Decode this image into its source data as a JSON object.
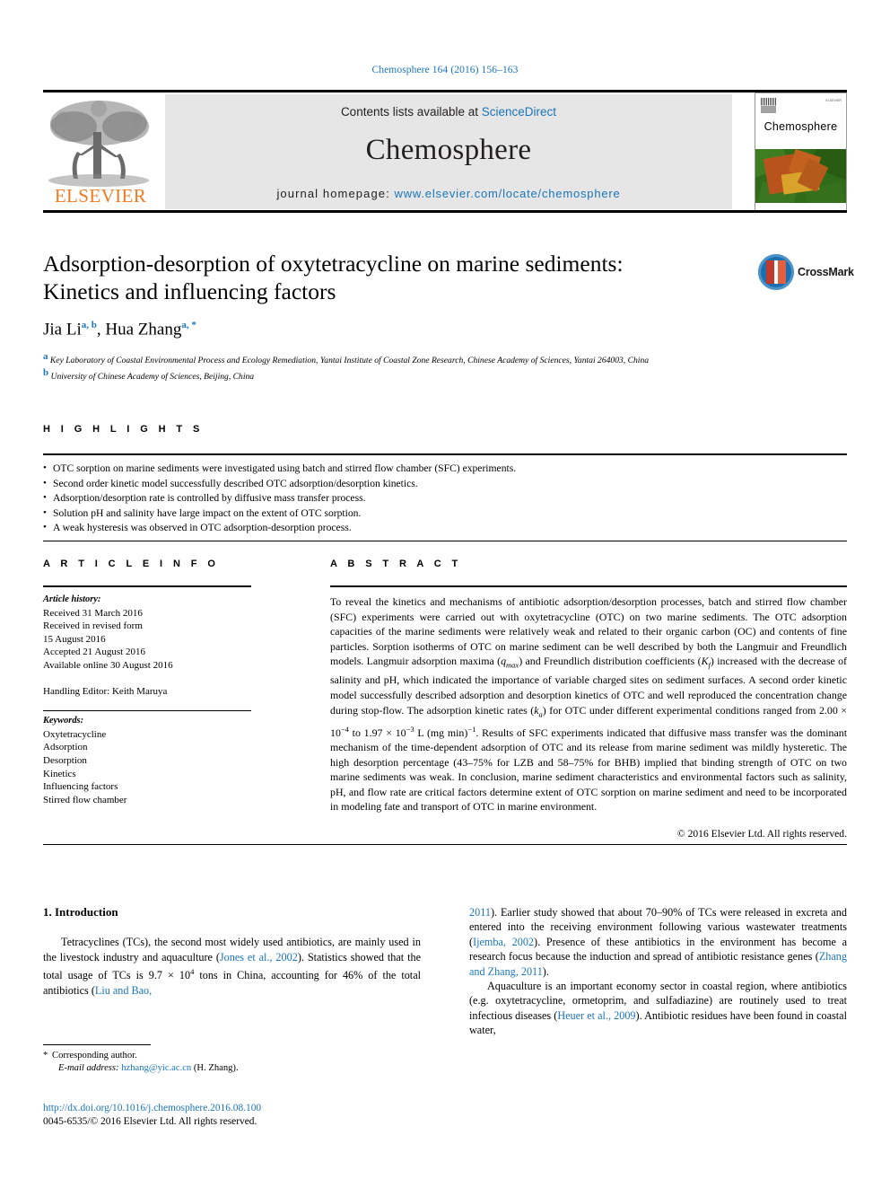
{
  "running_head": "Chemosphere 164 (2016) 156–163",
  "masthead": {
    "publisher_word": "ELSEVIER",
    "contents_prefix": "Contents lists available at ",
    "contents_link": "ScienceDirect",
    "journal_name": "Chemosphere",
    "homepage_prefix": "journal homepage: ",
    "homepage_url": "www.elsevier.com/locate/chemosphere",
    "cover_title": "Chemosphere",
    "cover_tiny_text": "ELSEVIER"
  },
  "crossmark": {
    "label": "CrossMark"
  },
  "article": {
    "title_line1": "Adsorption-desorption of oxytetracycline on marine sediments:",
    "title_line2": "Kinetics and influencing factors",
    "author1": "Jia Li",
    "author1_marks": "a, b",
    "author2": "Hua Zhang",
    "author2_marks": "a, *",
    "affiliation_a_mark": "a",
    "affiliation_a": "Key Laboratory of Coastal Environmental Process and Ecology Remediation, Yantai Institute of Coastal Zone Research, Chinese Academy of Sciences, Yantai 264003, China",
    "affiliation_b_mark": "b",
    "affiliation_b": "University of Chinese Academy of Sciences, Beijing, China"
  },
  "highlights": {
    "heading": "H I G H L I G H T S",
    "items": [
      "OTC sorption on marine sediments were investigated using batch and stirred flow chamber (SFC) experiments.",
      "Second order kinetic model successfully described OTC adsorption/desorption kinetics.",
      "Adsorption/desorption rate is controlled by diffusive mass transfer process.",
      "Solution pH and salinity have large impact on the extent of OTC sorption.",
      "A weak hysteresis was observed in OTC adsorption-desorption process."
    ]
  },
  "article_info": {
    "heading": "A R T I C L E  I N F O",
    "history_label": "Article history:",
    "history_lines": [
      "Received 31 March 2016",
      "Received in revised form",
      "15 August 2016",
      "Accepted 21 August 2016",
      "Available online 30 August 2016"
    ],
    "handling_editor": "Handling Editor: Keith Maruya",
    "keywords_label": "Keywords:",
    "keywords": [
      "Oxytetracycline",
      "Adsorption",
      "Desorption",
      "Kinetics",
      "Influencing factors",
      "Stirred flow chamber"
    ]
  },
  "abstract": {
    "heading": "A B S T R A C T",
    "paragraph_part1": "To reveal the kinetics and mechanisms of antibiotic adsorption/desorption processes, batch and stirred flow chamber (SFC) experiments were carried out with oxytetracycline (OTC) on two marine sediments. The OTC adsorption capacities of the marine sediments were relatively weak and related to their organic carbon (OC) and contents of fine particles. Sorption isotherms of OTC on marine sediment can be well described by both the Langmuir and Freundlich models. Langmuir adsorption maxima (",
    "qmax_symbol": "q",
    "qmax_sub": "max",
    "paragraph_part2": ") and Freundlich distribution coefficients (",
    "kf_symbol": "K",
    "kf_sub": "f",
    "paragraph_part3": ") increased with the decrease of salinity and pH, which indicated the importance of variable charged sites on sediment surfaces. A second order kinetic model successfully described adsorption and desorption kinetics of OTC and well reproduced the concentration change during stop-flow. The adsorption kinetic rates (",
    "ka_symbol": "k",
    "ka_sub": "a",
    "paragraph_part4": ") for OTC under different experimental conditions ranged from 2.00 × 10",
    "exp1": "−4",
    "paragraph_part5": " to 1.97 × 10",
    "exp2": "−3",
    "paragraph_part6": " L (mg min)",
    "exp3": "−1",
    "paragraph_part7": ". Results of SFC experiments indicated that diffusive mass transfer was the dominant mechanism of the time-dependent adsorption of OTC and its release from marine sediment was mildly hysteretic. The high desorption percentage (43–75% for LZB and 58–75% for BHB) implied that binding strength of OTC on two marine sediments was weak. In conclusion, marine sediment characteristics and environmental factors such as salinity, pH, and flow rate are critical factors determine extent of OTC sorption on marine sediment and need to be incorporated in modeling fate and transport of OTC in marine environment.",
    "copyright": "© 2016 Elsevier Ltd. All rights reserved."
  },
  "body": {
    "section_heading": "1. Introduction",
    "left_para1_a": "Tetracyclines (TCs), the second most widely used antibiotics, are mainly used in the livestock industry and aquaculture (",
    "left_cite1": "Jones et al., 2002",
    "left_para1_b": "). Statistics showed that the total usage of TCs is 9.7 × 10",
    "left_exp": "4",
    "left_para1_c": " tons in China, accounting for 46% of the total antibiotics (",
    "left_cite2": "Liu and Bao,",
    "right_cite2_cont": "2011",
    "right_para1_a": "). Earlier study showed that about 70–90% of TCs were released in excreta and entered into the receiving environment following various wastewater treatments (",
    "right_cite3": "Ijemba, 2002",
    "right_para1_b": "). Presence of these antibiotics in the environment has become a research focus because the induction and spread of antibiotic resistance genes (",
    "right_cite4": "Zhang and Zhang, 2011",
    "right_para1_c": ").",
    "right_para2_a": "Aquaculture is an important economy sector in coastal region, where antibiotics (e.g. oxytetracycline, ormetoprim, and sulfadiazine) are routinely used to treat infectious diseases (",
    "right_cite5": "Heuer et al., 2009",
    "right_para2_b": "). Antibiotic residues have been found in coastal water,"
  },
  "footer": {
    "corresponding_star": "*",
    "corresponding_text": "Corresponding author.",
    "email_label": "E-mail address:",
    "email": "hzhang@yic.ac.cn",
    "email_suffix": "(H. Zhang).",
    "doi_url": "http://dx.doi.org/10.1016/j.chemosphere.2016.08.100",
    "issn_line": "0045-6535/© 2016 Elsevier Ltd. All rights reserved."
  },
  "colors": {
    "link_blue": "#1b75bb",
    "elsevier_orange": "#ee7b23",
    "masthead_grey": "#e6e6e6"
  }
}
